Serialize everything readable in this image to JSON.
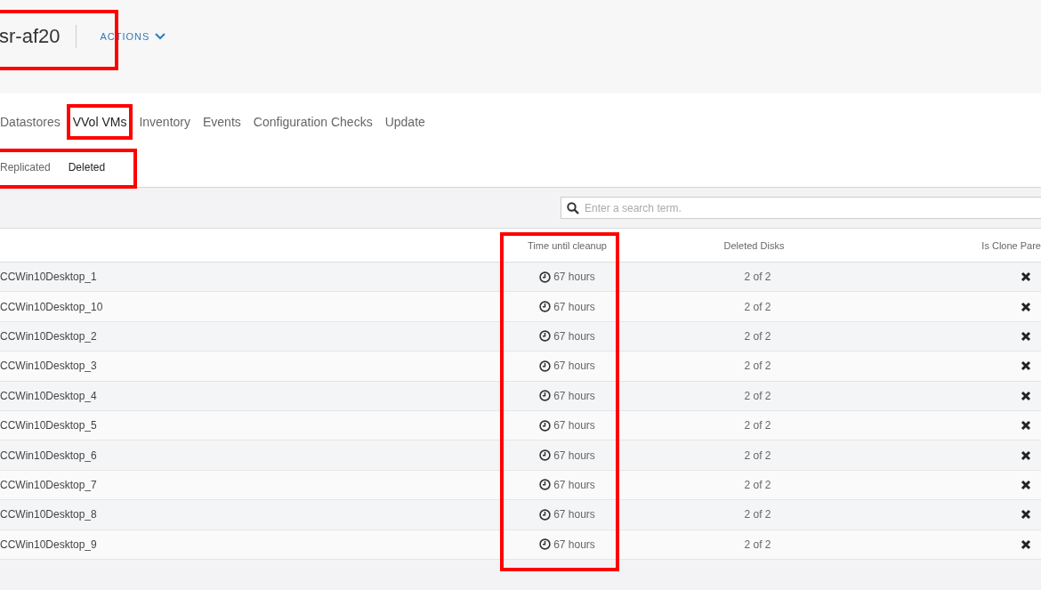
{
  "header": {
    "title": "sr-af20",
    "actions": "ACTIONS",
    "highlighted": true
  },
  "tabs": [
    {
      "label": "Datastores",
      "selected": false,
      "highlighted": false
    },
    {
      "label": "VVol VMs",
      "selected": true,
      "highlighted": true
    },
    {
      "label": "Inventory",
      "selected": false,
      "highlighted": false
    },
    {
      "label": "Events",
      "selected": false,
      "highlighted": false
    },
    {
      "label": "Configuration Checks",
      "selected": false,
      "highlighted": false
    },
    {
      "label": "Update",
      "selected": false,
      "highlighted": false
    }
  ],
  "subtabs_highlighted": true,
  "subtabs": [
    {
      "label": "Replicated",
      "selected": false
    },
    {
      "label": "Deleted",
      "selected": true
    }
  ],
  "search": {
    "placeholder": "Enter a search term."
  },
  "table": {
    "columns": [
      {
        "label": "Time until cleanup",
        "highlighted": true
      },
      {
        "label": "Deleted Disks",
        "highlighted": false
      },
      {
        "label": "Is Clone Pare",
        "highlighted": false
      }
    ],
    "rows": [
      {
        "name": "CCWin10Desktop_1",
        "time": "67 hours",
        "disks": "2 of 2",
        "is_clone_parent": false
      },
      {
        "name": "CCWin10Desktop_10",
        "time": "67 hours",
        "disks": "2 of 2",
        "is_clone_parent": false
      },
      {
        "name": "CCWin10Desktop_2",
        "time": "67 hours",
        "disks": "2 of 2",
        "is_clone_parent": false
      },
      {
        "name": "CCWin10Desktop_3",
        "time": "67 hours",
        "disks": "2 of 2",
        "is_clone_parent": false
      },
      {
        "name": "CCWin10Desktop_4",
        "time": "67 hours",
        "disks": "2 of 2",
        "is_clone_parent": false
      },
      {
        "name": "CCWin10Desktop_5",
        "time": "67 hours",
        "disks": "2 of 2",
        "is_clone_parent": false
      },
      {
        "name": "CCWin10Desktop_6",
        "time": "67 hours",
        "disks": "2 of 2",
        "is_clone_parent": false
      },
      {
        "name": "CCWin10Desktop_7",
        "time": "67 hours",
        "disks": "2 of 2",
        "is_clone_parent": false
      },
      {
        "name": "CCWin10Desktop_8",
        "time": "67 hours",
        "disks": "2 of 2",
        "is_clone_parent": false
      },
      {
        "name": "CCWin10Desktop_9",
        "time": "67 hours",
        "disks": "2 of 2",
        "is_clone_parent": false
      }
    ]
  }
}
